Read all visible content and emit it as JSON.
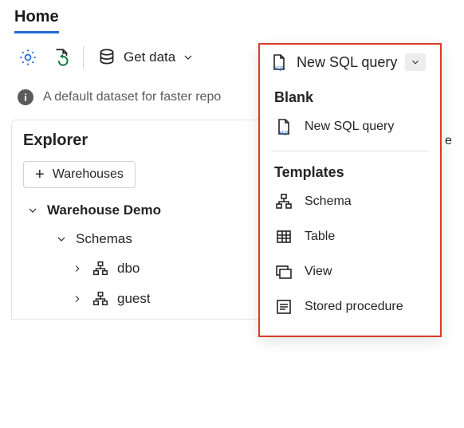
{
  "tabs": {
    "home": "Home"
  },
  "toolbar": {
    "get_data": "Get data",
    "new_sql_query": "New SQL query"
  },
  "info": {
    "text": "A default dataset for faster repo",
    "truncated_char": "e"
  },
  "explorer": {
    "title": "Explorer",
    "add_button": "Warehouses",
    "tree": {
      "warehouse": "Warehouse Demo",
      "schemas_label": "Schemas",
      "schemas": [
        "dbo",
        "guest"
      ]
    }
  },
  "dropdown": {
    "head_label": "New SQL query",
    "section_blank": "Blank",
    "blank_item": "New SQL query",
    "section_templates": "Templates",
    "templates": {
      "schema": "Schema",
      "table": "Table",
      "view": "View",
      "stored_procedure": "Stored procedure"
    }
  }
}
